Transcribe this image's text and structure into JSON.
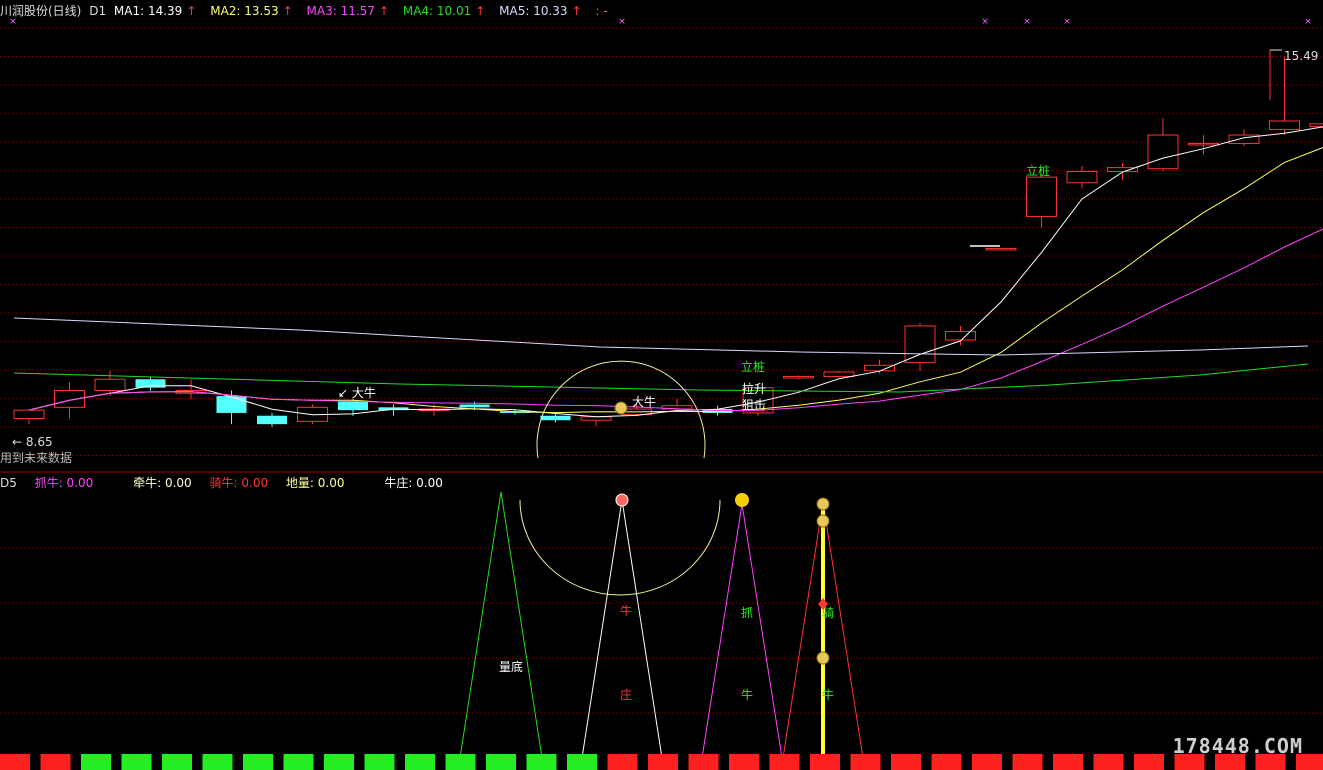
{
  "header": {
    "stock_title": "川润股份(日线)",
    "period": "D1",
    "ma1": "MA1: 14.39",
    "ma2": "MA2: 13.53",
    "ma3": "MA3: 11.57",
    "ma4": "MA4: 10.01",
    "ma5": "MA5: 10.33",
    "arrow": "↑",
    "extra": ": -"
  },
  "colors": {
    "ma1": "#ffffff",
    "ma2": "#ffff66",
    "ma3": "#ff44ff",
    "ma4": "#22dd22",
    "ma5": "#d9d9ff",
    "up": "#ff3333",
    "down": "#54ffff",
    "grid": "#8a0000"
  },
  "price_labels": {
    "high": "15.49",
    "low": "8.65",
    "future_note": "用到未来数据"
  },
  "annotations": {
    "da_niu_1": "大牛",
    "da_niu_2": "大牛",
    "li_zhuang_1": "立桩",
    "li_zhuang_2": "立桩",
    "la_sheng": "拉升",
    "ju_ji": "狙击"
  },
  "indicator": {
    "name": "D5",
    "zhua_niu": "抓牛: 0.00",
    "qian_niu": "牵牛: 0.00",
    "qi_niu": "骑牛: 0.00",
    "di_liang": "地量: 0.00",
    "niu_zhuang": "牛庄: 0.00",
    "label_liangdi": "量底",
    "label_niu_red": "牛",
    "label_zhuang": "庄",
    "label_zhua": "抓",
    "label_niu_green": "牛",
    "label_qi": "骑",
    "label_niu_green2": "牛"
  },
  "watermark": "178448.COM",
  "candles": [
    {
      "o": 9.05,
      "c": 9.2,
      "h": 9.2,
      "l": 8.95
    },
    {
      "o": 9.25,
      "c": 9.55,
      "h": 9.7,
      "l": 9.05
    },
    {
      "o": 9.55,
      "c": 9.75,
      "h": 9.9,
      "l": 9.45
    },
    {
      "o": 9.75,
      "c": 9.6,
      "h": 9.8,
      "l": 9.55
    },
    {
      "o": 9.5,
      "c": 9.55,
      "h": 9.75,
      "l": 9.4
    },
    {
      "o": 9.45,
      "c": 9.15,
      "h": 9.55,
      "l": 8.95
    },
    {
      "o": 9.1,
      "c": 8.95,
      "h": 9.15,
      "l": 8.9
    },
    {
      "o": 9.0,
      "c": 9.25,
      "h": 9.3,
      "l": 8.95
    },
    {
      "o": 9.35,
      "c": 9.2,
      "h": 9.4,
      "l": 9.1
    },
    {
      "o": 9.25,
      "c": 9.2,
      "h": 9.3,
      "l": 9.1
    },
    {
      "o": 9.2,
      "c": 9.22,
      "h": 9.3,
      "l": 9.1
    },
    {
      "o": 9.3,
      "c": 9.25,
      "h": 9.35,
      "l": 9.2
    },
    {
      "o": 9.18,
      "c": 9.15,
      "h": 9.2,
      "l": 9.12
    },
    {
      "o": 9.1,
      "c": 9.02,
      "h": 9.15,
      "l": 8.98
    },
    {
      "o": 9.02,
      "c": 9.08,
      "h": 9.1,
      "l": 8.92
    },
    {
      "o": 9.12,
      "c": 9.22,
      "h": 9.3,
      "l": 9.1
    },
    {
      "o": 9.22,
      "c": 9.28,
      "h": 9.4,
      "l": 9.18
    },
    {
      "o": 9.22,
      "c": 9.15,
      "h": 9.28,
      "l": 9.1
    },
    {
      "o": 9.15,
      "c": 9.6,
      "h": 9.65,
      "l": 9.1
    },
    {
      "o": 9.8,
      "c": 9.8,
      "h": 9.82,
      "l": 9.75
    },
    {
      "o": 9.8,
      "c": 9.88,
      "h": 9.9,
      "l": 9.78
    },
    {
      "o": 9.9,
      "c": 10.0,
      "h": 10.1,
      "l": 9.85
    },
    {
      "o": 10.05,
      "c": 10.7,
      "h": 10.75,
      "l": 9.9
    },
    {
      "o": 10.45,
      "c": 10.6,
      "h": 10.7,
      "l": 10.35
    },
    {
      "o": 12.08,
      "c": 12.08,
      "h": 12.08,
      "l": 12.08
    },
    {
      "o": 12.65,
      "c": 13.35,
      "h": 13.4,
      "l": 12.45
    },
    {
      "o": 13.25,
      "c": 13.45,
      "h": 13.55,
      "l": 13.15
    },
    {
      "o": 13.45,
      "c": 13.52,
      "h": 13.6,
      "l": 13.3
    },
    {
      "o": 13.5,
      "c": 14.1,
      "h": 14.4,
      "l": 13.45
    },
    {
      "o": 13.95,
      "c": 13.95,
      "h": 14.1,
      "l": 13.75
    },
    {
      "o": 13.95,
      "c": 14.1,
      "h": 14.2,
      "l": 13.9
    },
    {
      "o": 14.2,
      "c": 14.35,
      "h": 15.49,
      "l": 14.1
    },
    {
      "o": 14.25,
      "c": 14.3,
      "h": 14.45,
      "l": 14.05
    }
  ]
}
